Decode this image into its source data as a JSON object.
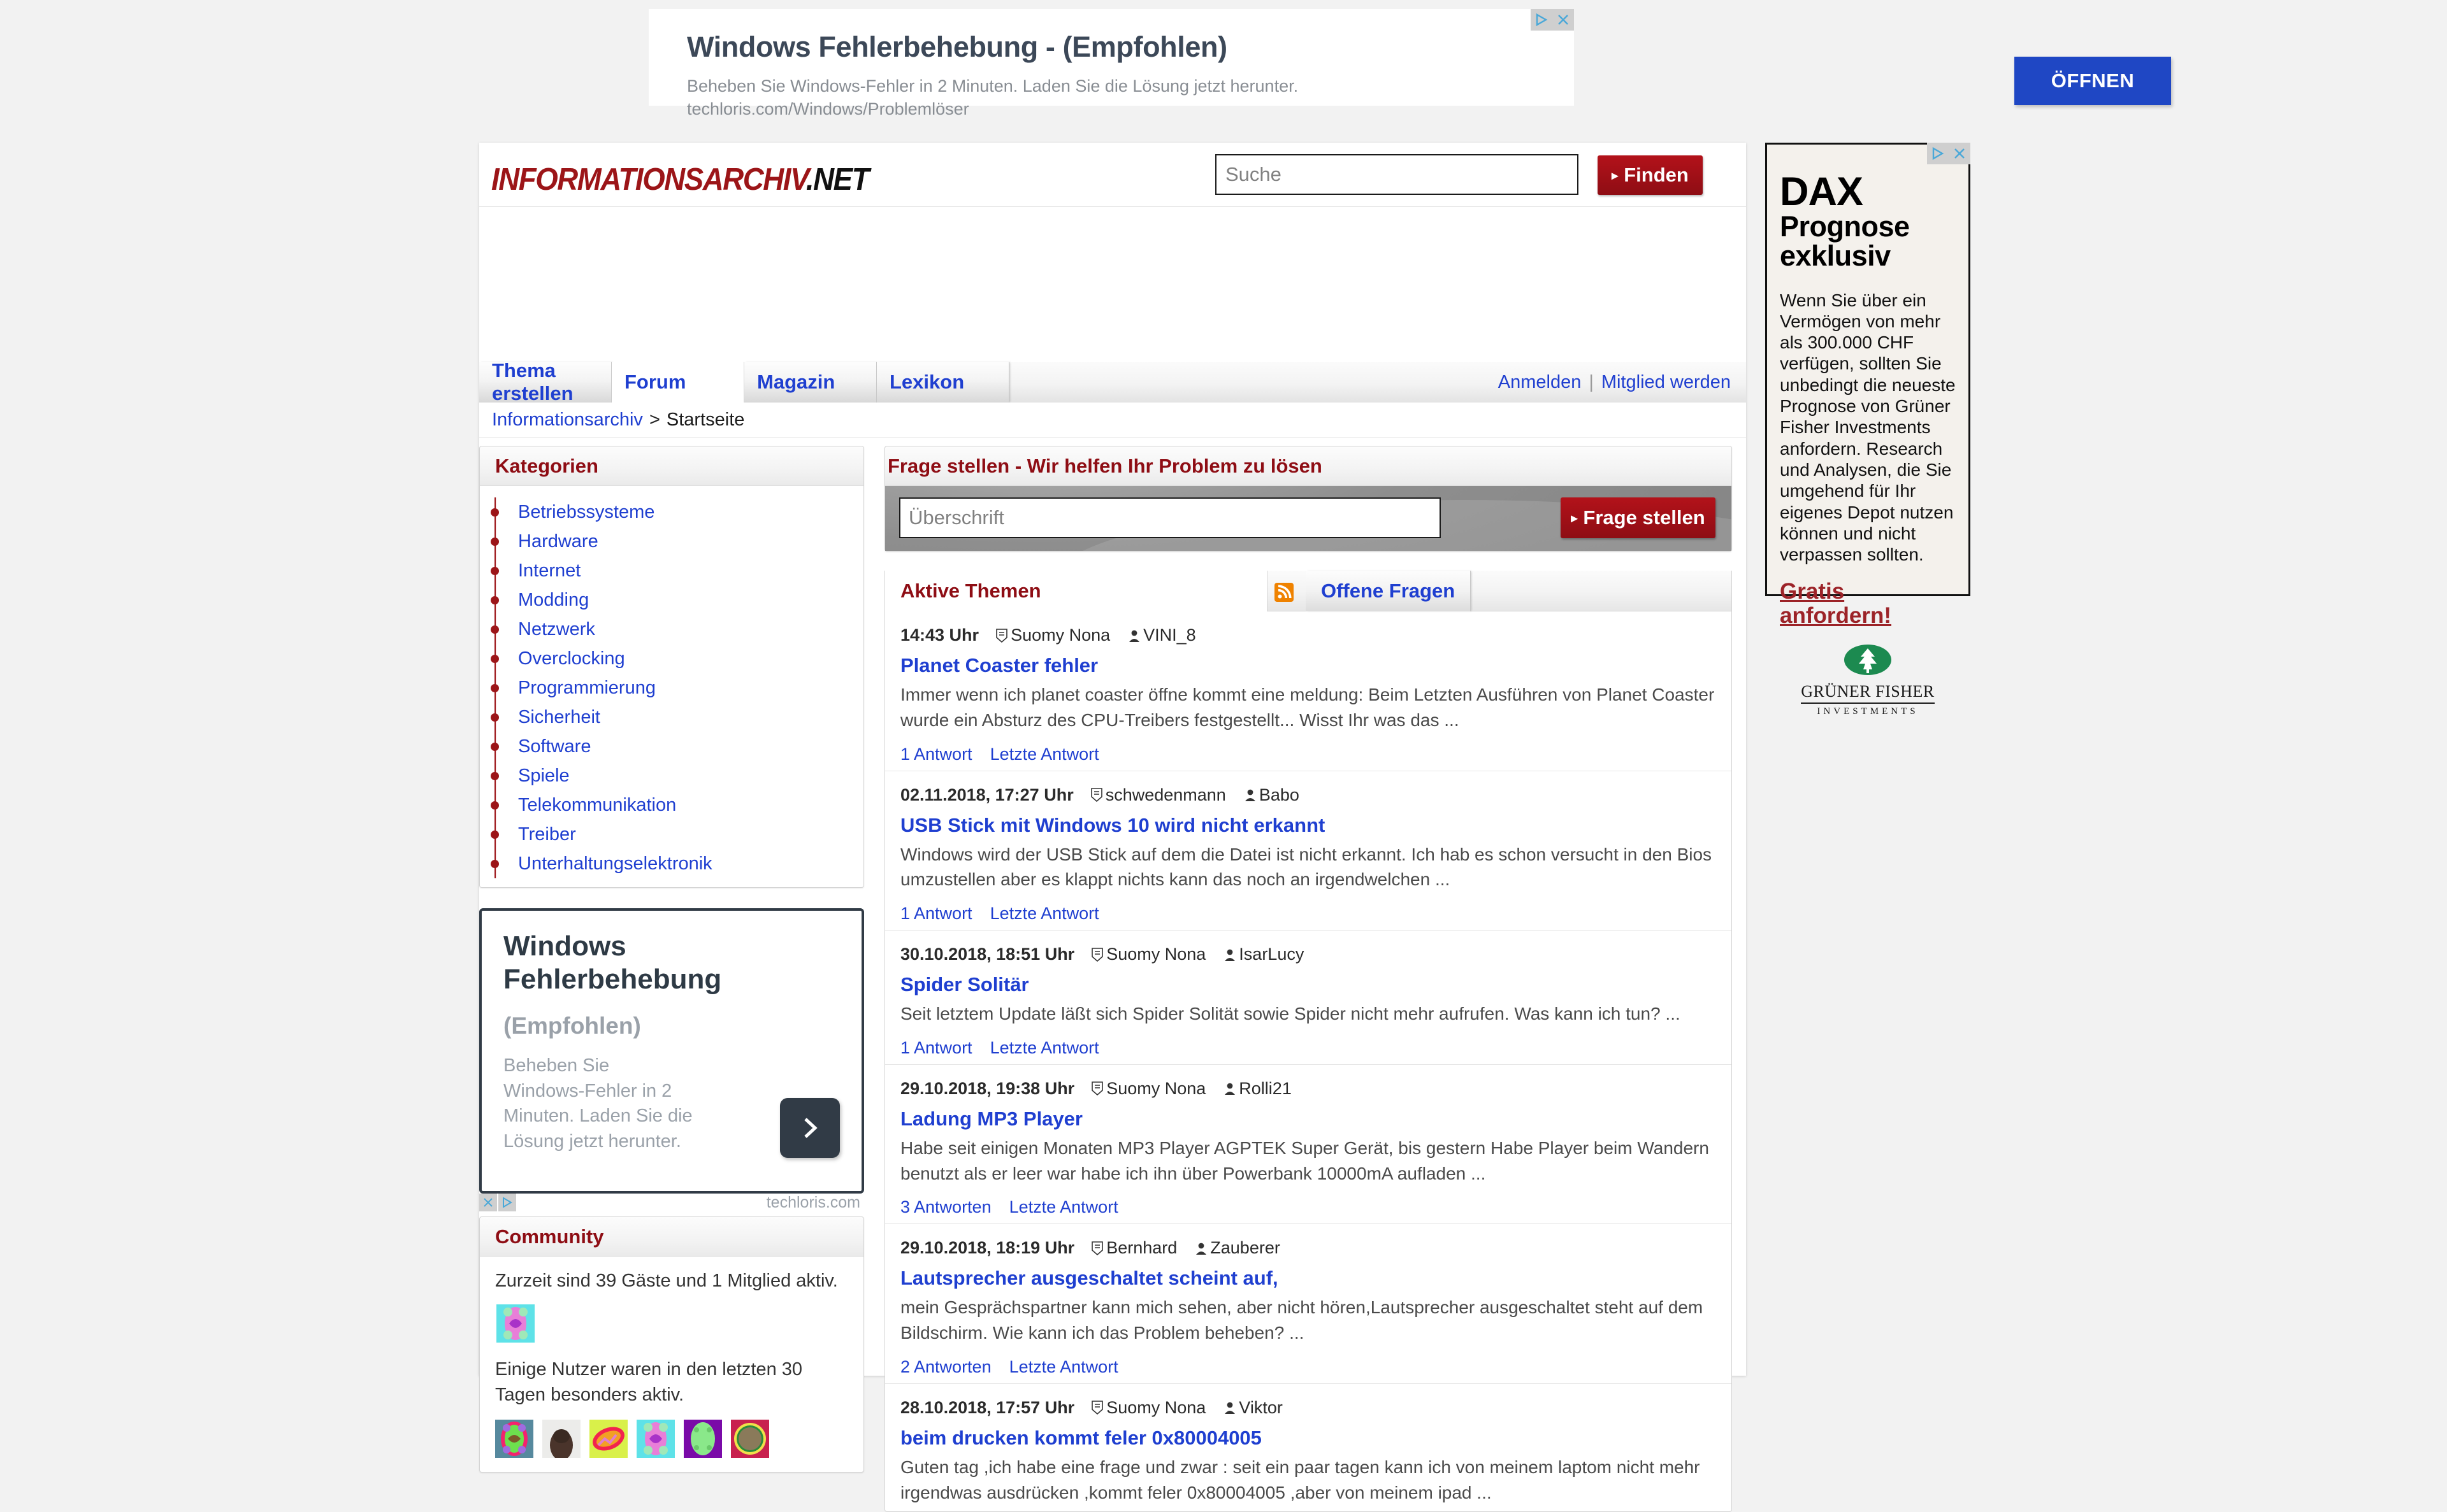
{
  "top_ad": {
    "headline": "Windows Fehlerbehebung - (Empfohlen)",
    "description": "Beheben Sie Windows-Fehler in 2 Minuten. Laden Sie die Lösung jetzt herunter.",
    "display_url": "techloris.com/Windows/Problemlöser",
    "button_label": "ÖFFNEN"
  },
  "header": {
    "logo_main": "INFORMATIONSARCHIV",
    "logo_tld": ".NET",
    "search_placeholder": "Suche",
    "search_value": "",
    "find_button": "Finden"
  },
  "nav": {
    "tabs": [
      {
        "label": "Thema erstellen",
        "active": false
      },
      {
        "label": "Forum",
        "active": true
      },
      {
        "label": "Magazin",
        "active": false
      },
      {
        "label": "Lexikon",
        "active": false
      }
    ],
    "login": "Anmelden",
    "separator": "|",
    "register": "Mitglied werden"
  },
  "breadcrumb": {
    "root": "Informationsarchiv",
    "chevron": ">",
    "current": "Startseite"
  },
  "sidebar": {
    "categories_title": "Kategorien",
    "categories": [
      "Betriebssysteme",
      "Hardware",
      "Internet",
      "Modding",
      "Netzwerk",
      "Overclocking",
      "Programmierung",
      "Sicherheit",
      "Software",
      "Spiele",
      "Telekommunikation",
      "Treiber",
      "Unterhaltungselektronik"
    ],
    "ad": {
      "headline": "Windows Fehlerbehebung",
      "sub": "(Empfohlen)",
      "description": "Beheben Sie Windows-Fehler in 2 Minuten. Laden Sie die Lösung jetzt herunter.",
      "domain": "techloris.com"
    },
    "community_title": "Community",
    "community_online": "Zurzeit sind 39 Gäste und 1 Mitglied aktiv.",
    "community_active_text": "Einige Nutzer waren in den letzten 30 Tagen besonders aktiv."
  },
  "main": {
    "ask_title": "Frage stellen - Wir helfen Ihr Problem zu lösen",
    "ask_placeholder": "Überschrift",
    "ask_value": "",
    "ask_button": "Frage stellen",
    "tab_active": "Aktive Themen",
    "tab_open": "Offene Fragen",
    "threads": [
      {
        "date": "14:43 Uhr",
        "group": "Suomy Nona",
        "user": "VINI_8",
        "title": "Planet Coaster fehler",
        "excerpt": "Immer wenn ich planet coaster öffne kommt eine meldung: Beim Letzten Ausführen von Planet Coaster wurde ein Absturz des CPU-Treibers festgestellt... Wisst Ihr was das ...",
        "answers": "1 Antwort",
        "last_answer": "Letzte Antwort"
      },
      {
        "date": "02.11.2018, 17:27 Uhr",
        "group": "schwedenmann",
        "user": "Babo",
        "title": "USB Stick mit Windows 10 wird nicht erkannt",
        "excerpt": "Windows wird der USB Stick auf dem die Datei ist nicht erkannt. Ich hab es schon versucht in den Bios umzustellen aber es klappt nichts kann das noch an irgendwelchen ...",
        "answers": "1 Antwort",
        "last_answer": "Letzte Antwort"
      },
      {
        "date": "30.10.2018, 18:51 Uhr",
        "group": "Suomy Nona",
        "user": "IsarLucy",
        "title": "Spider Solitär",
        "excerpt": "Seit letztem Update läßt sich Spider Solität sowie Spider nicht mehr aufrufen. Was kann ich tun? ...",
        "answers": "1 Antwort",
        "last_answer": "Letzte Antwort"
      },
      {
        "date": "29.10.2018, 19:38 Uhr",
        "group": "Suomy Nona",
        "user": "Rolli21",
        "title": "Ladung MP3 Player",
        "excerpt": "Habe seit einigen Monaten MP3 Player AGPTEK Super Gerät, bis gestern Habe Player beim Wandern benutzt als er leer war habe ich ihn über Powerbank 10000mA aufladen ...",
        "answers": "3 Antworten",
        "last_answer": "Letzte Antwort"
      },
      {
        "date": "29.10.2018, 18:19 Uhr",
        "group": "Bernhard",
        "user": "Zauberer",
        "title": "Lautsprecher ausgeschaltet scheint auf,",
        "excerpt": "mein Gesprächspartner kann mich sehen, aber nicht hören,Lautsprecher ausgeschaltet steht auf dem Bildschirm. Wie kann ich das Problem beheben? ...",
        "answers": "2 Antworten",
        "last_answer": "Letzte Antwort"
      },
      {
        "date": "28.10.2018, 17:57 Uhr",
        "group": "Suomy Nona",
        "user": "Viktor",
        "title": "beim drucken kommt feler 0x80004005",
        "excerpt": "Guten tag ,ich habe eine frage und zwar : seit ein paar tagen kann ich von meinem laptom nicht mehr irgendwas ausdrücken ,kommt feler 0x80004005 ,aber von meinem ipad ...",
        "answers": "",
        "last_answer": ""
      }
    ]
  },
  "side_ad": {
    "line1": "DAX",
    "line2": "Prognose",
    "line3": "exklusiv",
    "body": "Wenn Sie über ein Vermögen von mehr als 300.000 CHF verfügen, sollten Sie unbedingt die neueste Prognose von Grüner Fisher Investments anfordern. Research und Analysen, die Sie umgehend für Ihr eigenes Depot nutzen können und nicht verpassen sollten.",
    "cta": "Gratis anfordern!",
    "brand": "GRÜNER FISHER",
    "brand_sub": "INVESTMENTS"
  },
  "colors": {
    "brand_red": "#8e0d14",
    "link_blue": "#1f3fd0",
    "ad_blue": "#1f47c4",
    "rss_orange": "#ef8200"
  }
}
